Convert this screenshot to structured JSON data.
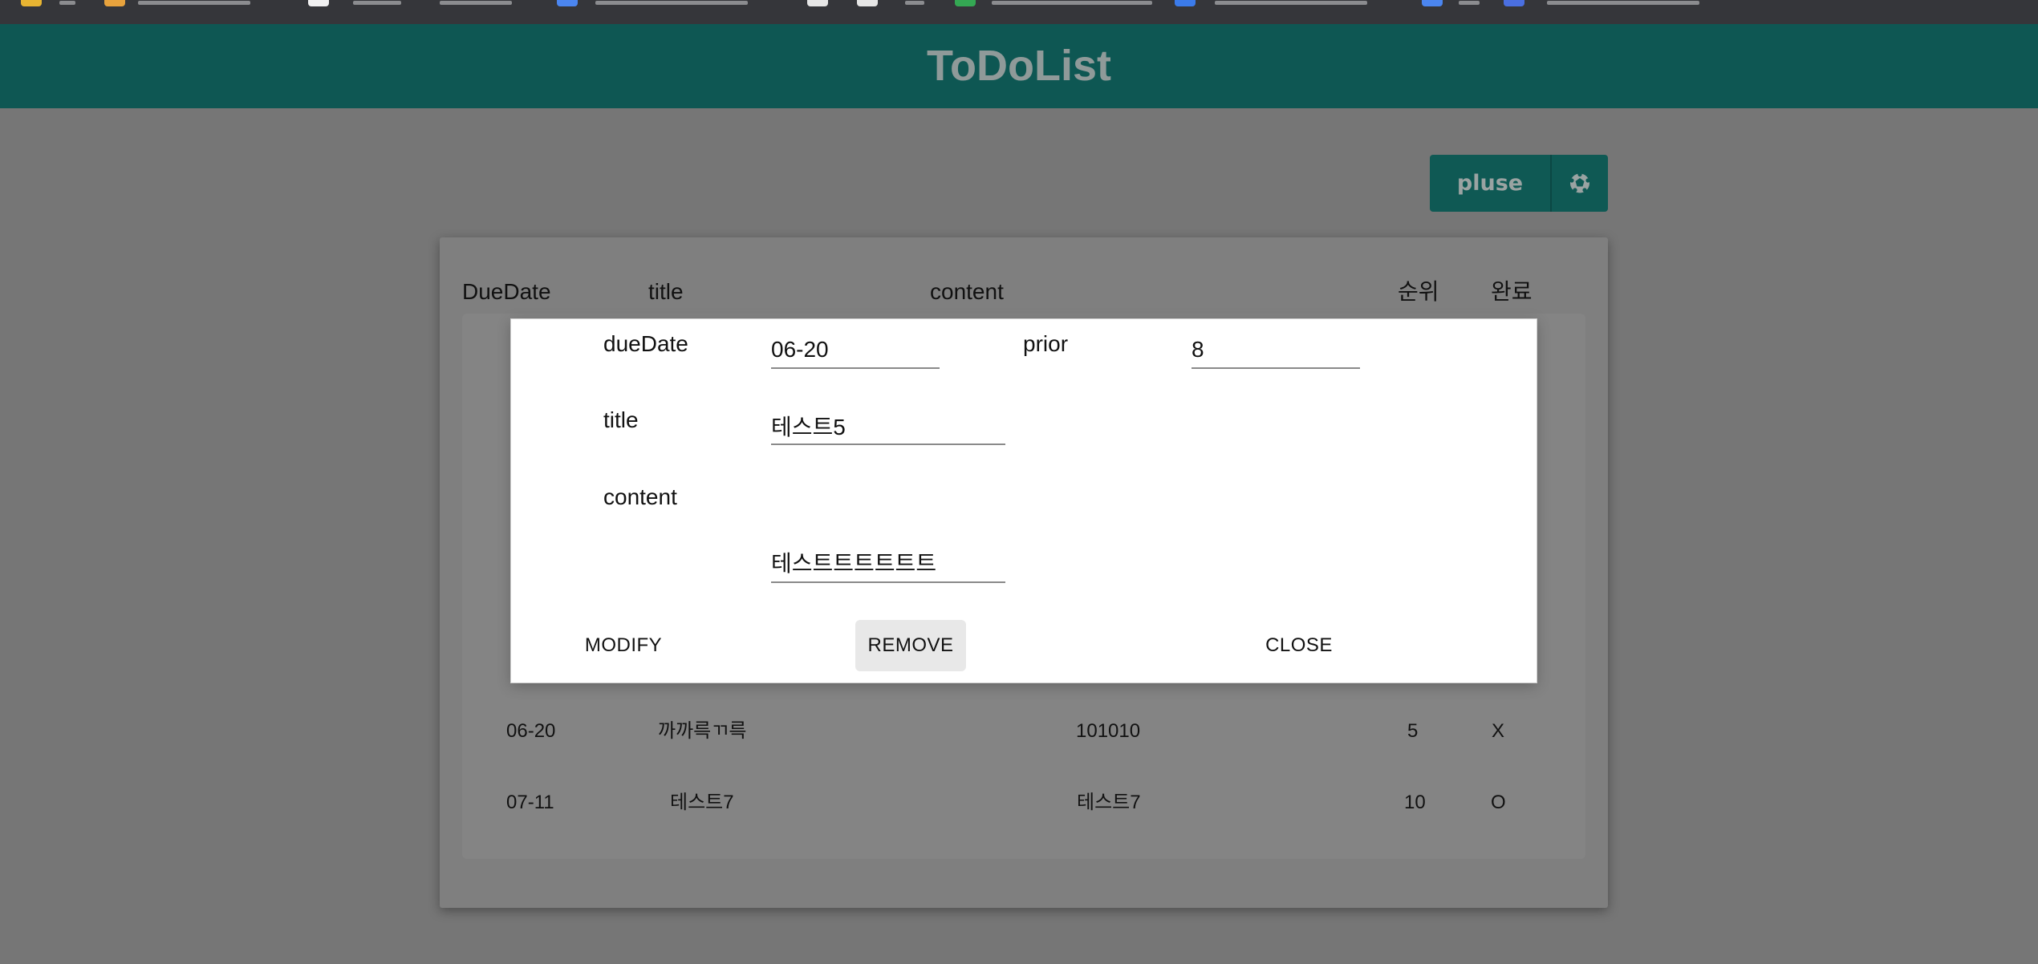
{
  "app": {
    "title": "ToDoList"
  },
  "toolbar": {
    "pluse_label": "pluse",
    "pluse_icon": "soccer-ball-icon"
  },
  "table": {
    "headers": {
      "due_date": "DueDate",
      "title": "title",
      "content": "content",
      "rank": "순위",
      "done": "완료"
    },
    "rows": [
      {
        "due_date": "06-20",
        "title": "까까륵ㄲ륵",
        "content": "101010",
        "rank": "5",
        "done": "X"
      },
      {
        "due_date": "07-11",
        "title": "테스트7",
        "content": "테스트7",
        "rank": "10",
        "done": "O"
      }
    ]
  },
  "modal": {
    "due_date_label": "dueDate",
    "due_date_value": "06-20",
    "prior_label": "prior",
    "prior_value": "8",
    "title_label": "title",
    "title_value": "테스트5",
    "content_label": "content",
    "content_value": "테스트트트트트트",
    "modify_label": "MODIFY",
    "remove_label": "REMOVE",
    "close_label": "CLOSE"
  },
  "colors": {
    "header_bg": "#0e5753",
    "overlay_bg": "#767676",
    "accent": "#0f5954"
  }
}
